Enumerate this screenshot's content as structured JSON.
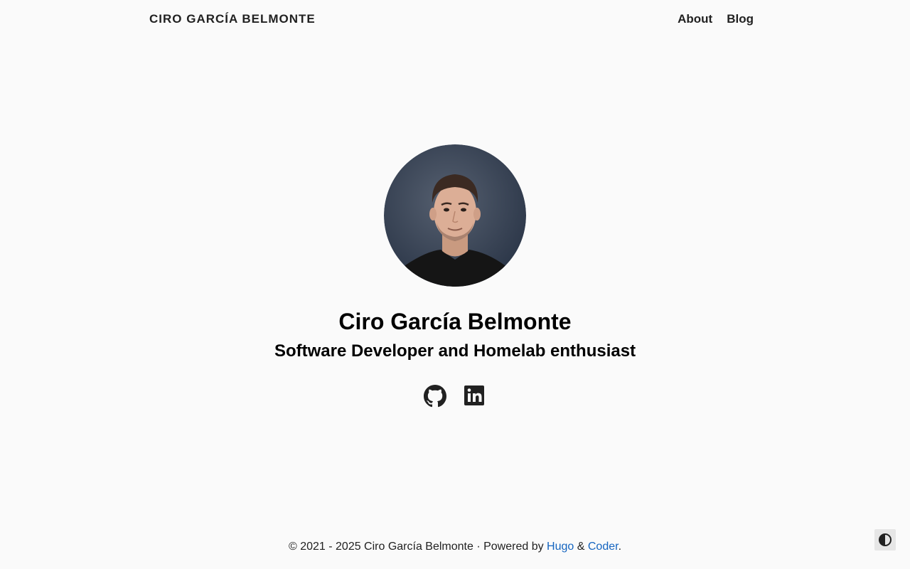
{
  "header": {
    "brand": "CIRO GARCÍA BELMONTE",
    "nav": [
      {
        "label": "About"
      },
      {
        "label": "Blog"
      }
    ]
  },
  "profile": {
    "name": "Ciro García Belmonte",
    "tagline": "Software Developer and Homelab enthusiast",
    "socials": [
      {
        "icon": "github-icon"
      },
      {
        "icon": "linkedin-icon"
      }
    ]
  },
  "footer": {
    "copyright": "© 2021 - 2025 Ciro García Belmonte · Powered by ",
    "hugo": "Hugo",
    "amp": " & ",
    "coder": "Coder",
    "end": "."
  },
  "colors": {
    "background": "#fafafa",
    "text": "#212121",
    "link": "#1565c0"
  },
  "theme_toggle": {
    "icon": "contrast-icon"
  }
}
